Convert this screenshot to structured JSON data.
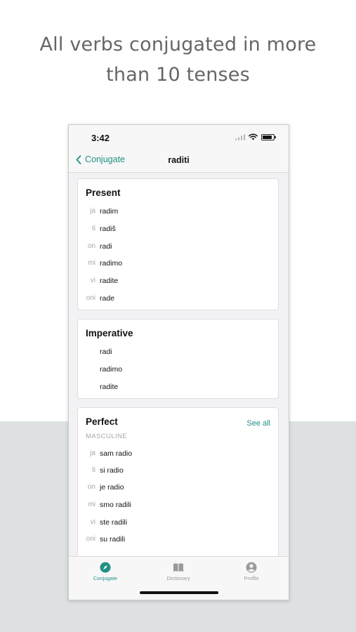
{
  "headline": {
    "line1": "All verbs conjugated in more",
    "line2": "than 10 tenses"
  },
  "status": {
    "time": "3:42"
  },
  "nav": {
    "back_label": "Conjugate",
    "title": "raditi"
  },
  "cards": {
    "present": {
      "title": "Present",
      "rows": [
        {
          "pronoun": "ja",
          "form": "radim"
        },
        {
          "pronoun": "ti",
          "form": "radiš"
        },
        {
          "pronoun": "on",
          "form": "radi"
        },
        {
          "pronoun": "mi",
          "form": "radimo"
        },
        {
          "pronoun": "vi",
          "form": "radite"
        },
        {
          "pronoun": "oni",
          "form": "rade"
        }
      ]
    },
    "imperative": {
      "title": "Imperative",
      "rows": [
        {
          "form": "radi"
        },
        {
          "form": "radimo"
        },
        {
          "form": "radite"
        }
      ]
    },
    "perfect": {
      "title": "Perfect",
      "see_all": "See all",
      "subtitle": "MASCULINE",
      "rows": [
        {
          "pronoun": "ja",
          "form": "sam radio"
        },
        {
          "pronoun": "ti",
          "form": "si radio"
        },
        {
          "pronoun": "on",
          "form": "je radio"
        },
        {
          "pronoun": "mi",
          "form": "smo radili"
        },
        {
          "pronoun": "vi",
          "form": "ste radili"
        },
        {
          "pronoun": "oni",
          "form": "su radili"
        }
      ]
    }
  },
  "tabs": [
    {
      "label": "Conjugate",
      "icon": "compass-icon",
      "active": true
    },
    {
      "label": "Dictionary",
      "icon": "book-icon",
      "active": false
    },
    {
      "label": "Profile",
      "icon": "profile-icon",
      "active": false
    }
  ],
  "colors": {
    "accent": "#1f9184",
    "inactive": "#9a9a9a",
    "band": "#dde1e1"
  }
}
